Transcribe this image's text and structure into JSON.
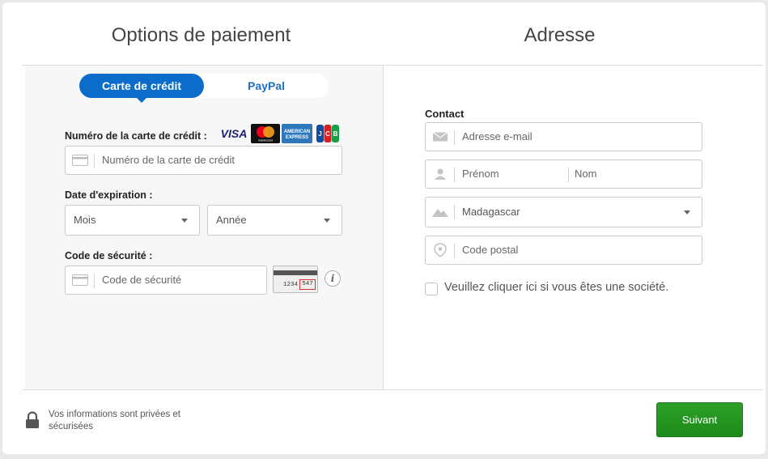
{
  "headers": {
    "payment_title": "Options de paiement",
    "address_title": "Adresse"
  },
  "payment": {
    "tabs": [
      {
        "label": "Carte de crédit",
        "active": true
      },
      {
        "label": "PayPal",
        "active": false
      }
    ],
    "card_number_label": "Numéro de la carte de crédit :",
    "card_number_placeholder": "Numéro de la carte de crédit",
    "card_logos": [
      "VISA",
      "mastercard",
      "AMERICAN EXPRESS",
      "JCB"
    ],
    "expiry_label": "Date d'expiration :",
    "month_value": "Mois",
    "year_value": "Année",
    "security_label": "Code de sécurité :",
    "security_placeholder": "Code de sécurité",
    "cvv_example_digits": "1234",
    "cvv_example_code": "547",
    "info_glyph": "i"
  },
  "address": {
    "contact_label": "Contact",
    "email_placeholder": "Adresse e-mail",
    "first_name_placeholder": "Prénom",
    "last_name_placeholder": "Nom",
    "country_value": "Madagascar",
    "postal_placeholder": "Code postal",
    "company_checkbox_label": "Veuillez cliquer ici si vous êtes une société."
  },
  "footer": {
    "privacy_text": "Vos informations sont privées et sécurisées",
    "next_label": "Suivant"
  },
  "colors": {
    "tab_active": "#0b6cc9",
    "next_button": "#24961f",
    "panel_bg": "#f7f7f7"
  }
}
